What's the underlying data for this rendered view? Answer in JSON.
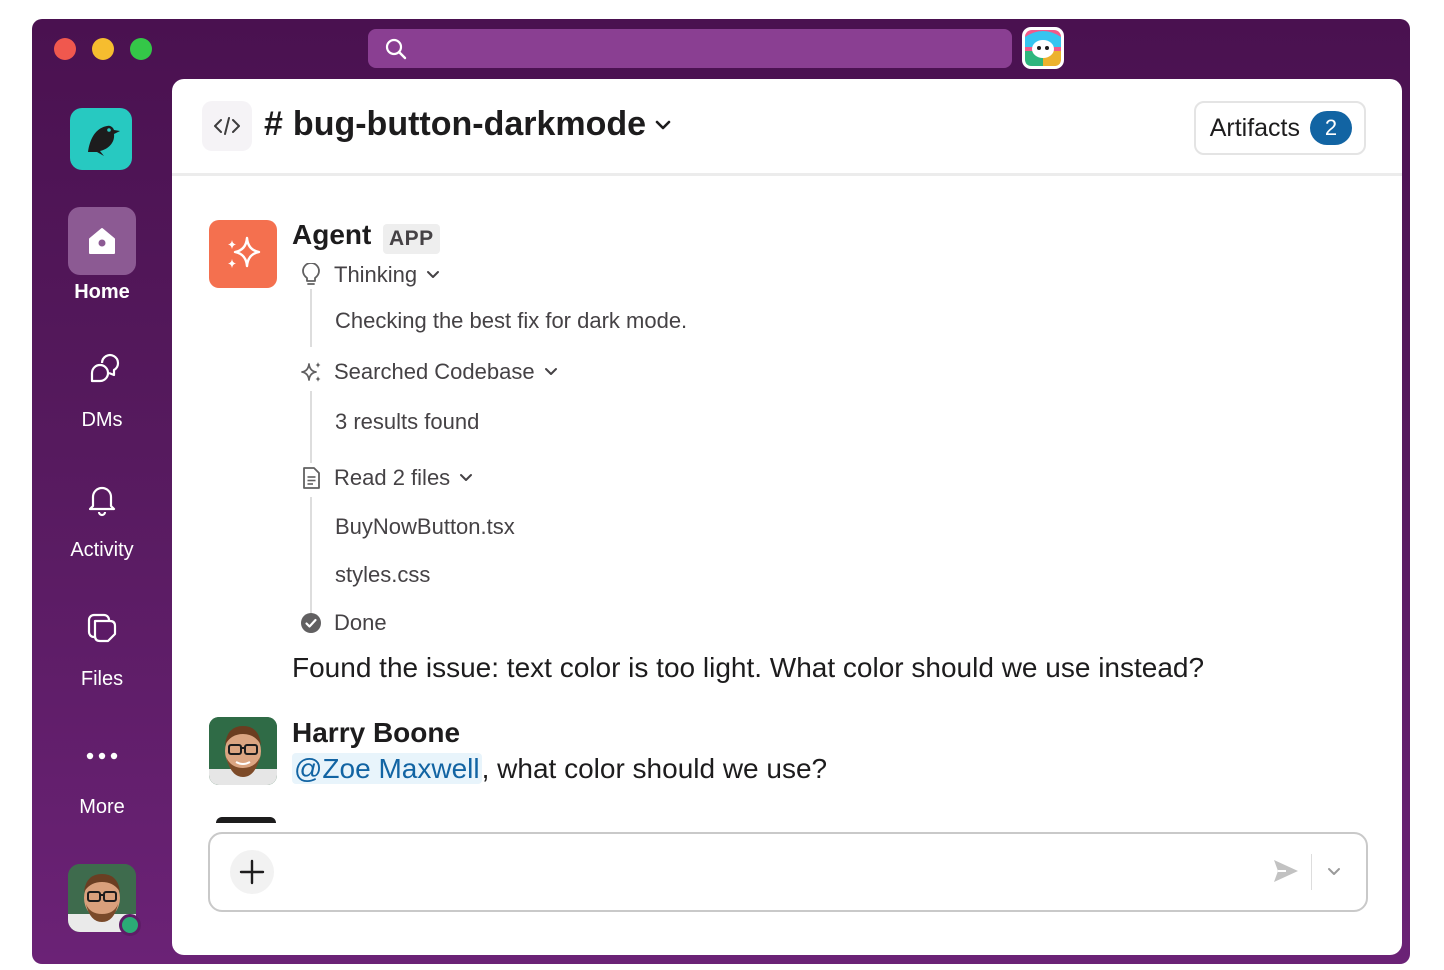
{
  "titlebar": {
    "search_icon": "search-icon",
    "app_icon": "app-icon"
  },
  "sidebar": {
    "workspace_icon": "bird-logo-icon",
    "items": [
      {
        "label": "Home",
        "icon": "home-icon",
        "active": true
      },
      {
        "label": "DMs",
        "icon": "dms-icon",
        "active": false
      },
      {
        "label": "Activity",
        "icon": "bell-icon",
        "active": false
      },
      {
        "label": "Files",
        "icon": "files-icon",
        "active": false
      },
      {
        "label": "More",
        "icon": "more-icon",
        "active": false
      }
    ],
    "presence_color": "#2bac76"
  },
  "header": {
    "channel_prefix": "#",
    "channel_name": "bug-button-darkmode",
    "artifacts_label": "Artifacts",
    "artifacts_count": "2"
  },
  "messages": [
    {
      "sender": "Agent",
      "tag": "APP",
      "steps": [
        {
          "label": "Thinking",
          "icon": "lightbulb-icon",
          "details": [
            "Checking the best fix for dark mode."
          ]
        },
        {
          "label": "Searched Codebase",
          "icon": "sparkle-icon",
          "details": [
            "3 results found"
          ]
        },
        {
          "label": "Read 2 files",
          "icon": "document-icon",
          "details": [
            "BuyNowButton.tsx",
            "styles.css"
          ]
        },
        {
          "label": "Done",
          "icon": "check-circle-icon",
          "details": []
        }
      ],
      "text": "Found the issue: text color is too light. What color should we use instead?"
    },
    {
      "sender": "Harry Boone",
      "mention": "@Zoe Maxwell",
      "text": ", what color should we use?"
    }
  ],
  "composer": {
    "placeholder": ""
  },
  "colors": {
    "window_bg": "#4a1150",
    "accent": "#1264a3",
    "agent_avatar": "#f4704f",
    "workspace_logo": "#27c9c1"
  }
}
